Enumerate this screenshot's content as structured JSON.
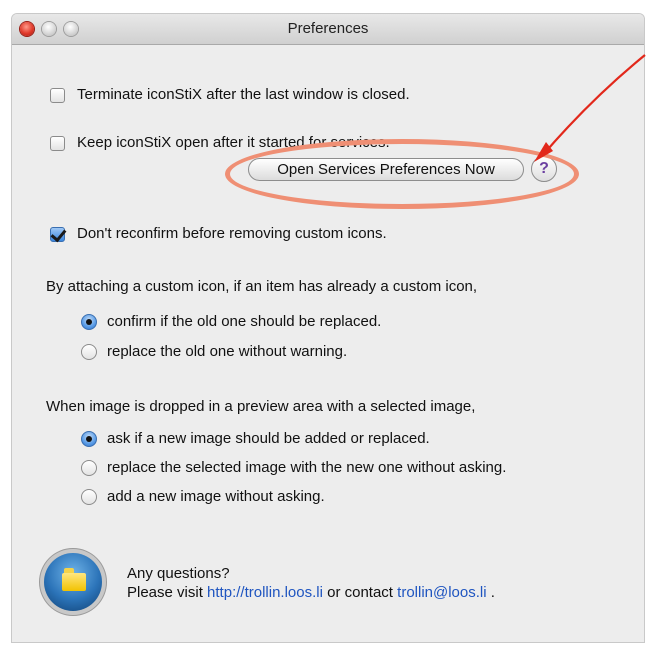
{
  "window": {
    "title": "Preferences"
  },
  "options": {
    "terminate_label": "Terminate iconStiX after the last window is closed.",
    "terminate_checked": false,
    "keep_open_label": "Keep iconStiX open after it started for services.",
    "keep_open_checked": false,
    "open_services_button": "Open Services Preferences Now",
    "help_glyph": "?",
    "no_reconfirm_label": "Don't reconfirm before removing custom icons.",
    "no_reconfirm_checked": true
  },
  "custom_icon_group": {
    "heading": "By attaching a custom icon, if an item has already a custom icon,",
    "options": [
      {
        "label": "confirm if the old one should be replaced.",
        "selected": true
      },
      {
        "label": "replace the old one without warning.",
        "selected": false
      }
    ]
  },
  "drop_group": {
    "heading": "When image is dropped in a preview area with a selected image,",
    "options": [
      {
        "label": "ask if a new image should be added or replaced.",
        "selected": true
      },
      {
        "label": "replace the selected image with the new one without asking.",
        "selected": false
      },
      {
        "label": "add a new image without asking.",
        "selected": false
      }
    ]
  },
  "footer": {
    "question": "Any questions?",
    "visit_prefix": "Please visit",
    "url": "http://trollin.loos.li",
    "contact_prefix": "or contact",
    "email": "trollin@loos.li",
    "period": "."
  },
  "icons": {
    "close": "close-traffic-light",
    "minimize": "minimize-traffic-light",
    "zoom": "zoom-traffic-light",
    "app": "iconstix-app-icon",
    "arrow": "red-annotation-arrow"
  },
  "colors": {
    "window_bg": "#ededed",
    "highlight_ring": "#ef8f74",
    "arrow": "#e2281b",
    "link": "#1f55c0",
    "help_glyph": "#6b3fa0"
  }
}
